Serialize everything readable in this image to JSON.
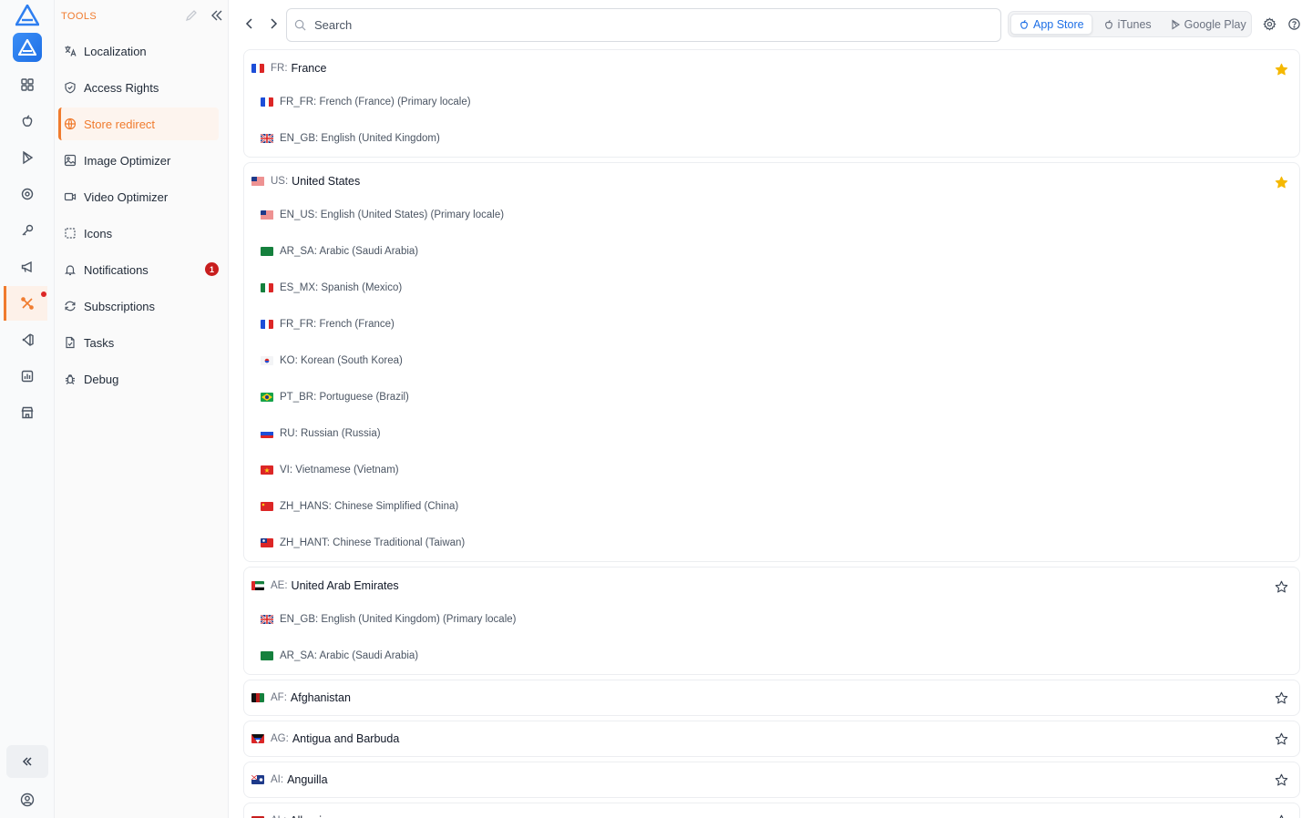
{
  "sidebar": {
    "heading": "TOOLS",
    "items": [
      {
        "label": "Localization",
        "icon": "translate-icon"
      },
      {
        "label": "Access Rights",
        "icon": "shield-icon"
      },
      {
        "label": "Store redirect",
        "icon": "globe-icon"
      },
      {
        "label": "Image Optimizer",
        "icon": "image-icon"
      },
      {
        "label": "Video Optimizer",
        "icon": "video-icon"
      },
      {
        "label": "Icons",
        "icon": "dashed-square-icon"
      },
      {
        "label": "Notifications",
        "icon": "bell-icon",
        "badge": "1"
      },
      {
        "label": "Subscriptions",
        "icon": "refresh-icon"
      },
      {
        "label": "Tasks",
        "icon": "file-check-icon"
      },
      {
        "label": "Debug",
        "icon": "bug-icon"
      }
    ],
    "active": "Store redirect"
  },
  "topbar": {
    "search_placeholder": "Search",
    "stores": [
      {
        "label": "App Store",
        "active": true
      },
      {
        "label": "iTunes",
        "active": false
      },
      {
        "label": "Google Play",
        "active": false
      }
    ]
  },
  "countries": [
    {
      "code": "FR:",
      "name": "France",
      "starred": true,
      "flag": "FR",
      "locales": [
        {
          "flag": "FR",
          "label": "FR_FR: French (France) (Primary locale)"
        },
        {
          "flag": "GB",
          "label": "EN_GB: English (United Kingdom)"
        }
      ]
    },
    {
      "code": "US:",
      "name": "United States",
      "starred": true,
      "flag": "US",
      "locales": [
        {
          "flag": "US",
          "label": "EN_US: English (United States) (Primary locale)"
        },
        {
          "flag": "SA",
          "label": "AR_SA: Arabic (Saudi Arabia)"
        },
        {
          "flag": "MX",
          "label": "ES_MX: Spanish (Mexico)"
        },
        {
          "flag": "FR",
          "label": "FR_FR: French (France)"
        },
        {
          "flag": "KR",
          "label": "KO: Korean (South Korea)"
        },
        {
          "flag": "BR",
          "label": "PT_BR: Portuguese (Brazil)"
        },
        {
          "flag": "RU",
          "label": "RU: Russian (Russia)"
        },
        {
          "flag": "VN",
          "label": "VI: Vietnamese (Vietnam)"
        },
        {
          "flag": "CN",
          "label": "ZH_HANS: Chinese Simplified (China)"
        },
        {
          "flag": "TW",
          "label": "ZH_HANT: Chinese Traditional (Taiwan)"
        }
      ]
    },
    {
      "code": "AE:",
      "name": "United Arab Emirates",
      "starred": false,
      "flag": "AE",
      "locales": [
        {
          "flag": "GB",
          "label": "EN_GB: English (United Kingdom) (Primary locale)"
        },
        {
          "flag": "SA",
          "label": "AR_SA: Arabic (Saudi Arabia)"
        }
      ]
    },
    {
      "code": "AF:",
      "name": "Afghanistan",
      "starred": false,
      "flag": "AF",
      "locales": []
    },
    {
      "code": "AG:",
      "name": "Antigua and Barbuda",
      "starred": false,
      "flag": "AG",
      "locales": []
    },
    {
      "code": "AI:",
      "name": "Anguilla",
      "starred": false,
      "flag": "AI",
      "locales": []
    },
    {
      "code": "AL:",
      "name": "Albania",
      "starred": false,
      "flag": "AL",
      "locales": []
    }
  ],
  "colors": {
    "accent": "#f07b2e",
    "active_store": "#1e6fe6",
    "star": "#f5b800",
    "badge": "#c81e1e"
  }
}
